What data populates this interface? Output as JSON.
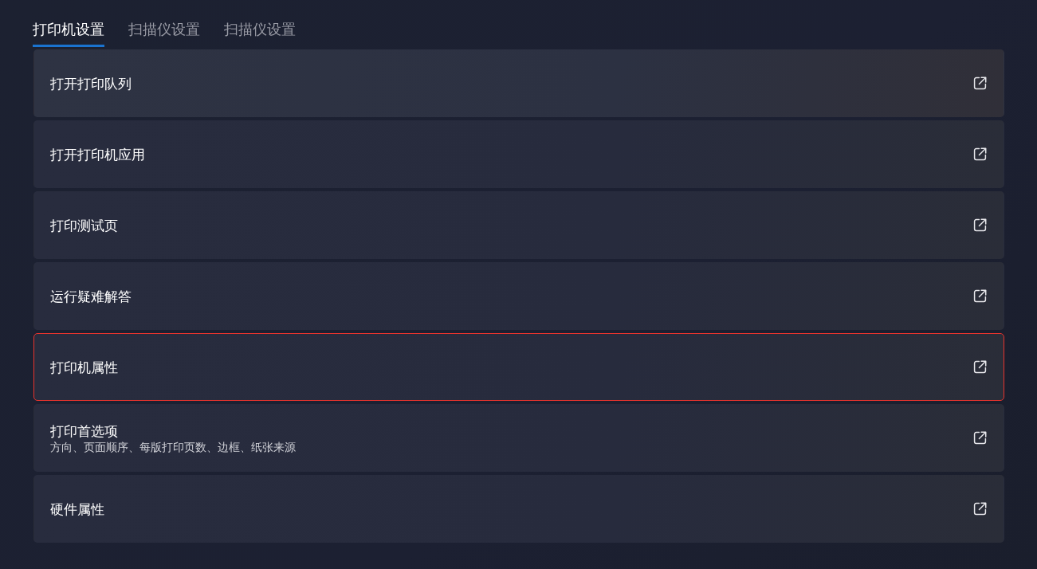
{
  "tabs": [
    {
      "label": "打印机设置",
      "selected": true
    },
    {
      "label": "扫描仪设置",
      "selected": false
    },
    {
      "label": "扫描仪设置",
      "selected": false
    }
  ],
  "items": [
    {
      "title": "打开打印队列",
      "highlighted": false
    },
    {
      "title": "打开打印机应用",
      "highlighted": false
    },
    {
      "title": "打印测试页",
      "highlighted": false
    },
    {
      "title": "运行疑难解答",
      "highlighted": false
    },
    {
      "title": "打印机属性",
      "highlighted": true
    },
    {
      "title": "打印首选项",
      "description": "方向、页面顺序、每版打印页数、边框、纸张来源",
      "highlighted": false
    },
    {
      "title": "硬件属性",
      "highlighted": false
    }
  ]
}
